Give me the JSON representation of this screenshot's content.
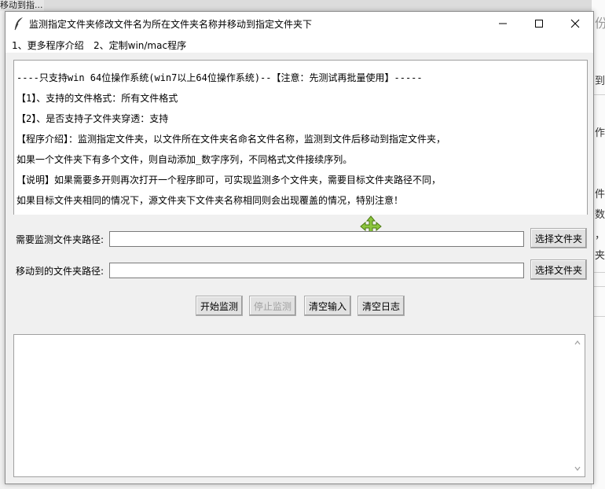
{
  "background": {
    "left_tab_text": "移动到指...",
    "right_fragments": [
      "份",
      "到",
      "作",
      "件",
      "数",
      "，",
      "夹"
    ]
  },
  "window": {
    "title": "监测指定文件夹修改文件名为所在文件夹名称并移动到指定文件夹下"
  },
  "menu": {
    "items": [
      "1、更多程序介绍",
      "2、定制win/mac程序"
    ]
  },
  "info": {
    "lines": [
      "----只支持win 64位操作系统(win7以上64位操作系统)--【注意：先测试再批量使用】-----",
      "【1】、支持的文件格式：所有文件格式",
      "【2】、是否支持子文件夹穿透：支持",
      "【程序介绍】：监测指定文件夹，以文件所在文件夹名命名文件名称，监测到文件后移动到指定文件夹，",
      "如果一个文件夹下有多个文件，则自动添加_数字序列，不同格式文件接续序列。",
      "【说明】如果需要多开则再次打开一个程序即可，可实现监测多个文件夹，需要目标文件夹路径不同，",
      "如果目标文件夹相同的情况下，源文件夹下文件夹名称相同则会出现覆盖的情况，特别注意！"
    ]
  },
  "form": {
    "watch_label": "需要监测文件夹路径:",
    "watch_value": "",
    "target_label": "移动到的文件夹路径:",
    "target_value": "",
    "browse_label": "选择文件夹"
  },
  "actions": {
    "start": "开始监测",
    "stop": "停止监测",
    "clear_input": "清空输入",
    "clear_log": "清空日志"
  },
  "log": {
    "content": ""
  }
}
